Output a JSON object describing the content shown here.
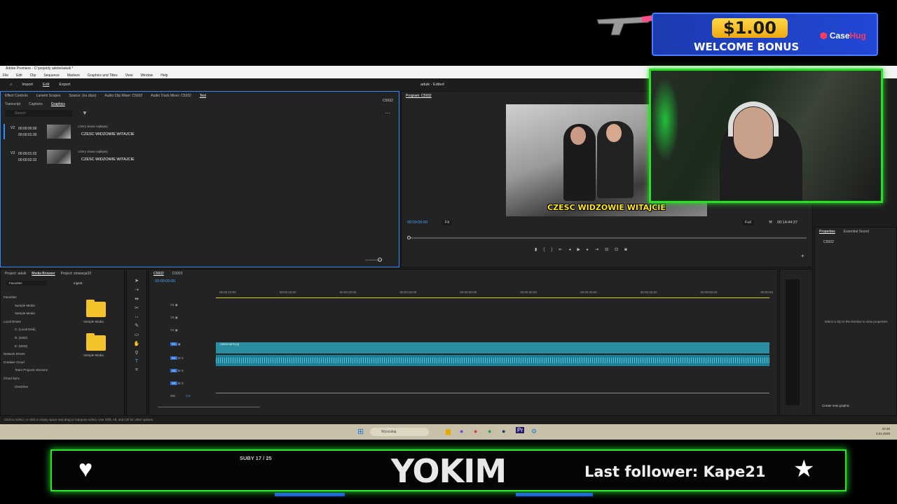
{
  "app": {
    "window_title": "Adobe Premiere - C:\\projekty adobe\\aduik *",
    "project_title": "aduik - Edited",
    "menus": [
      "File",
      "Edit",
      "Clip",
      "Sequence",
      "Markers",
      "Graphics and Titles",
      "View",
      "Window",
      "Help"
    ],
    "workspace_tabs": [
      "Import",
      "Edit",
      "Export"
    ]
  },
  "source_panel": {
    "tabs": [
      "Effect Controls",
      "Lumetri Scopes",
      "Source: (no clips)",
      "Audio Clip Mixer: C5932",
      "Audio Track Mixer: C5932",
      "Text"
    ],
    "subtabs": [
      "Transcript",
      "Captions",
      "Graphics"
    ],
    "sequence_label": "C5932",
    "search_placeholder": "Search",
    "items": [
      {
        "track": "V2",
        "in": "00:00:00:00",
        "out": "00:00:01:30",
        "subtitle": "cztery slowa najlepiej",
        "text": "CZESC WIDZOWIE WITAJCIE"
      },
      {
        "track": "V3",
        "in": "00:00:01:02",
        "out": "00:00:02:32",
        "subtitle": "cztery slowa najlepiej",
        "text": "CZESC WIDZOWIE WITAJCIE"
      }
    ]
  },
  "program": {
    "title": "Program: C5932",
    "caption": "CZESC WIDZOWIE WITAJCIE",
    "timecode": "00:00:00:00",
    "fit": "Fit",
    "quality": "Full",
    "duration": "00:14:44:37"
  },
  "properties": {
    "tabs": [
      "Properties",
      "Essential Sound"
    ],
    "sequence": "C5932",
    "empty_msg": "Select a clip in the timeline to view properties.",
    "create_button": "Create new graphic"
  },
  "project": {
    "tabs": [
      "Project: aduik",
      "Media Browser",
      "Project: stowacja33"
    ],
    "dropdown": "Favorites",
    "ingest": "Ingest",
    "tree": [
      "Favorites",
      "Sample Media",
      "Sample Media",
      "Local Drives",
      "C: (Local Disk)",
      "D: (SSD)",
      "E: (HDD)",
      "Network Drives",
      "Creative Cloud",
      "Team Projects Versions",
      "Cloud Sync",
      "OneDrive"
    ],
    "folders": [
      "Sample Media",
      "Sample Media"
    ]
  },
  "timeline": {
    "tabs": [
      "C5932",
      "C0003"
    ],
    "timecode": "00:00:00:00",
    "ruler": [
      "00:00:10:00",
      "00:00:15:00",
      "00:00:20:00",
      "00:00:25:00",
      "00:00:30:00",
      "00:00:35:00",
      "00:00:40:00",
      "00:00:45:00",
      "00:00:50:00",
      "00:00:55"
    ],
    "tracks": [
      "V4",
      "V3",
      "V2",
      "V1",
      "A1",
      "A2",
      "A3",
      "Mix"
    ],
    "mix_value": "0.0",
    "clip_label": "C5932.MP4 [V]"
  },
  "status_bar": "Click to select, or click in empty space and drag to marquee select. Use Shift, Alt, and Ctrl for other options.",
  "taskbar": {
    "search": "Wyszukaj",
    "time": "22:36",
    "date": "3.04.2026"
  },
  "overlay": {
    "promo_amount": "$1.00",
    "promo_text": "WELCOME BONUS",
    "promo_brand_a": "Case",
    "promo_brand_b": "Hug",
    "subs": "SUBY 17 / 25",
    "streamer": "YOKIM",
    "last_follower": "Last follower: Kape21"
  },
  "colors": {
    "accent_blue": "#2d8cff",
    "overlay_green": "#29e82b",
    "clip_teal": "#2a8ea0",
    "caption_yellow": "#ffe71a"
  }
}
